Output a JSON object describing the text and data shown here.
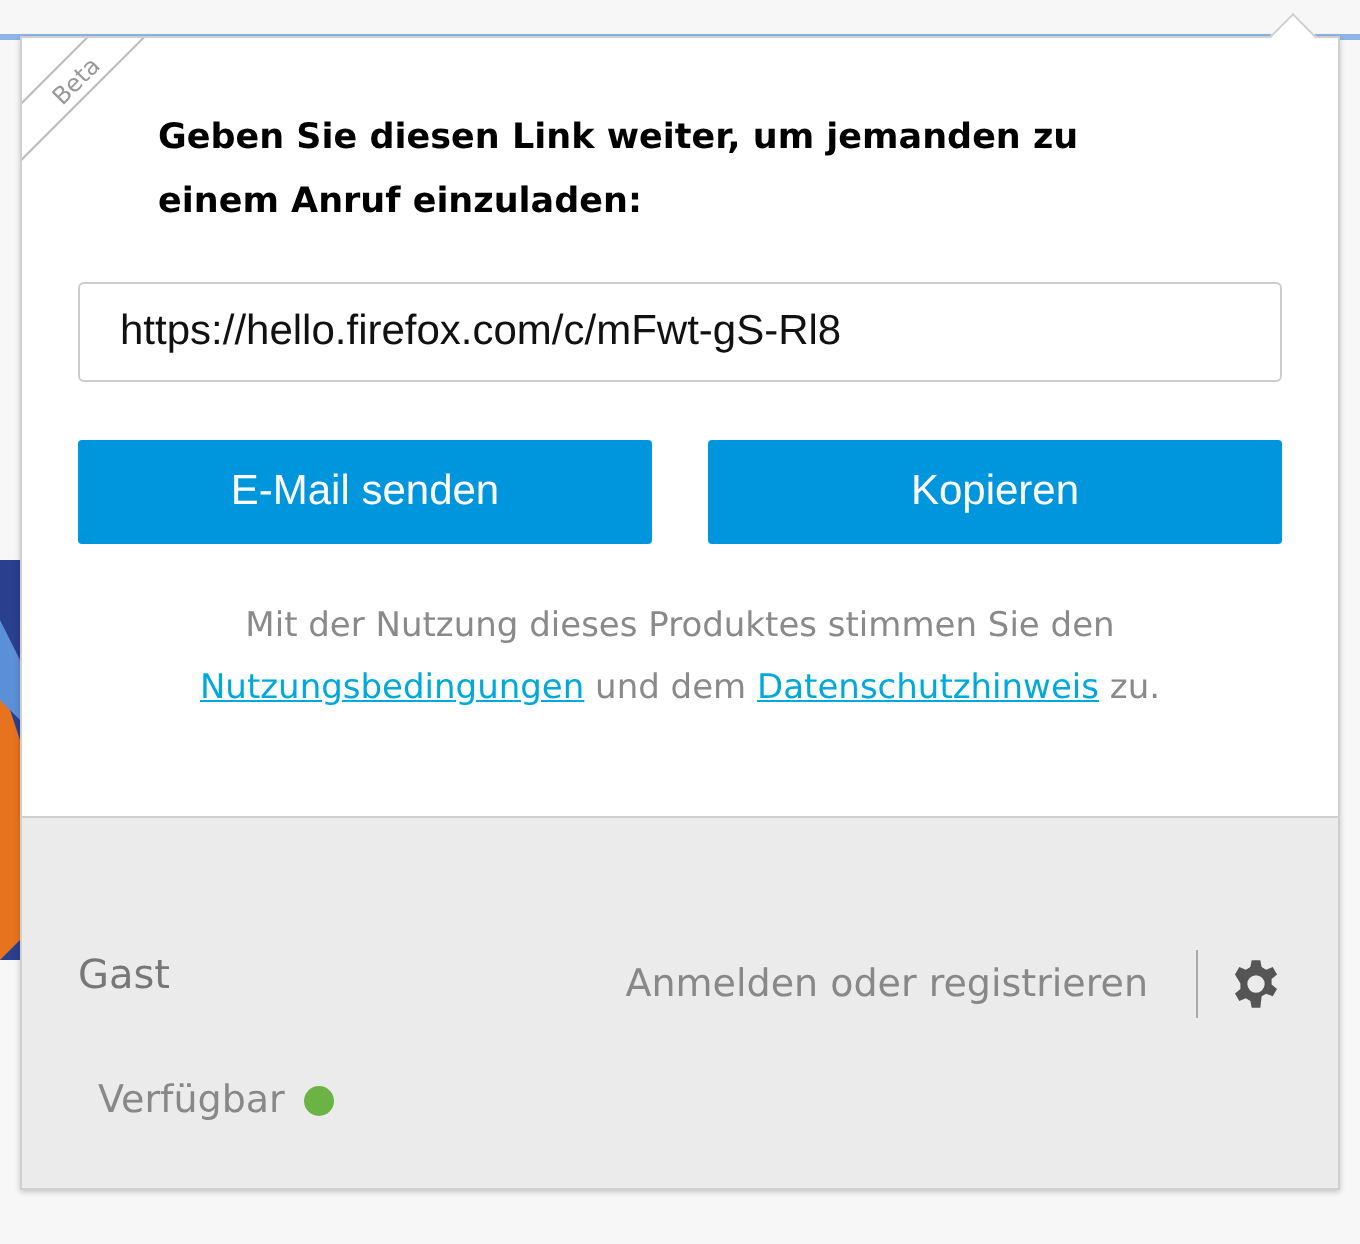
{
  "panel": {
    "badge": "Beta",
    "heading": "Geben Sie diesen Link weiter, um jemanden zu einem Anruf einzuladen:",
    "link_field": {
      "value": "https://hello.firefox.com/c/mFwt-gS-Rl8"
    },
    "buttons": [
      "E-Mail senden",
      "Kopieren"
    ],
    "terms": {
      "before": "Mit der Nutzung dieses Produktes stimmen Sie den",
      "link_1": "Nutzungsbedingungen",
      "middle": "und dem",
      "link_2": "Datenschutzhinweis",
      "after": "zu."
    }
  },
  "footer": {
    "user": "Gast",
    "sign_in": "Anmelden oder registrieren",
    "status": {
      "label": "Verfügbar",
      "color": "#6ab344"
    }
  }
}
